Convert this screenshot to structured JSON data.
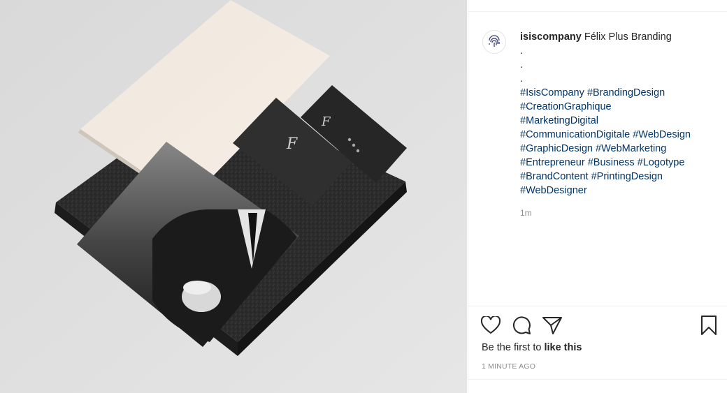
{
  "post": {
    "username": "isiscompany",
    "title": "Félix Plus Branding",
    "dots": [
      ".",
      ".",
      "."
    ],
    "hashtags": [
      "#IsisCompany",
      "#BrandingDesign",
      "#CreationGraphique",
      "#MarketingDigital",
      "#CommunicationDigitale",
      "#WebDesign",
      "#GraphicDesign",
      "#WebMarketing",
      "#Entrepreneur",
      "#Business",
      "#Logotype",
      "#BrandContent",
      "#PrintingDesign",
      "#WebDesigner"
    ],
    "caption_age": "1m",
    "likes_prefix": "Be the first to ",
    "likes_action": "like this",
    "timestamp": "1 MINUTE AGO"
  },
  "icons": {
    "avatar": "fingerprint-icon",
    "like": "heart-icon",
    "comment": "comment-icon",
    "share": "share-icon",
    "save": "bookmark-icon"
  },
  "colors": {
    "hashtag": "#003569",
    "secondary_text": "#8e8e8e",
    "divider": "#efefef"
  }
}
